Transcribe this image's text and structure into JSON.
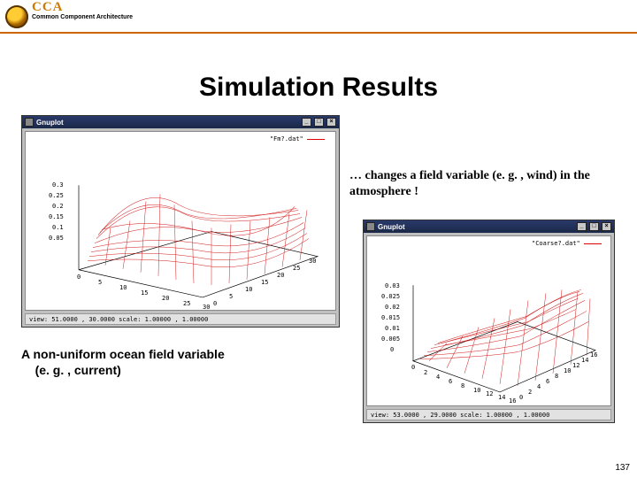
{
  "header": {
    "acronym": "CCA",
    "subtitle": "Common Component Architecture"
  },
  "title": "Simulation Results",
  "caption_right": "… changes a field variable (e. g. , wind) in the atmosphere !",
  "caption_left_l1": "A non-uniform ocean field variable",
  "caption_left_l2": "(e. g. , current)",
  "page_number": "137",
  "plot1": {
    "window_title": "Gnuplot",
    "legend": "\"Fm?.dat\"",
    "status": "view: 51.0000 , 30.0000   scale: 1.00000 , 1.00000",
    "z_ticks": [
      "0.3",
      "0.25",
      "0.2",
      "0.15",
      "0.1",
      "0.05"
    ],
    "x_ticks": [
      "0",
      "5",
      "10",
      "15",
      "20",
      "25",
      "30"
    ],
    "y_ticks": [
      "0",
      "5",
      "10",
      "15",
      "20",
      "25",
      "30"
    ]
  },
  "plot2": {
    "window_title": "Gnuplot",
    "legend": "\"Coarse?.dat\"",
    "status": "view: 53.0000 , 29.0000   scale: 1.00000 , 1.00000",
    "z_ticks": [
      "0.03",
      "0.025",
      "0.02",
      "0.015",
      "0.01",
      "0.005",
      "0"
    ],
    "x_ticks": [
      "0",
      "2",
      "4",
      "6",
      "8",
      "10",
      "12",
      "14",
      "16"
    ],
    "y_ticks": [
      "0",
      "2",
      "4",
      "6",
      "8",
      "10",
      "12",
      "14",
      "16"
    ]
  },
  "chart_data": [
    {
      "type": "surface",
      "title": "",
      "legend": [
        "Fm?.dat"
      ],
      "xlabel": "",
      "ylabel": "",
      "zlabel": "",
      "xlim": [
        0,
        30
      ],
      "ylim": [
        0,
        30
      ],
      "zlim": [
        0.05,
        0.3
      ],
      "x_ticks": [
        0,
        5,
        10,
        15,
        20,
        25,
        30
      ],
      "y_ticks": [
        0,
        5,
        10,
        15,
        20,
        25,
        30
      ],
      "z_ticks": [
        0.05,
        0.1,
        0.15,
        0.2,
        0.25,
        0.3
      ],
      "description": "3D wireframe surface over a 30×30 grid. The field is smooth, roughly planar near z≈0.1 across most of the domain, with a single positive bump near (x≈10, y≈25) peaking just above z≈0.3.",
      "samples": [
        {
          "x": 0,
          "y": 0,
          "z": 0.1
        },
        {
          "x": 30,
          "y": 0,
          "z": 0.1
        },
        {
          "x": 0,
          "y": 30,
          "z": 0.07
        },
        {
          "x": 30,
          "y": 30,
          "z": 0.07
        },
        {
          "x": 10,
          "y": 25,
          "z": 0.3
        },
        {
          "x": 15,
          "y": 15,
          "z": 0.11
        }
      ]
    },
    {
      "type": "surface",
      "title": "",
      "legend": [
        "Coarse?.dat"
      ],
      "xlabel": "",
      "ylabel": "",
      "zlabel": "",
      "xlim": [
        0,
        16
      ],
      "ylim": [
        0,
        16
      ],
      "zlim": [
        0,
        0.03
      ],
      "x_ticks": [
        0,
        2,
        4,
        6,
        8,
        10,
        12,
        14,
        16
      ],
      "y_ticks": [
        0,
        2,
        4,
        6,
        8,
        10,
        12,
        14,
        16
      ],
      "z_ticks": [
        0,
        0.005,
        0.01,
        0.015,
        0.02,
        0.025,
        0.03
      ],
      "description": "3D wireframe surface over a 16×16 grid. A single broad hump centered near (x≈14, y≈8) rising smoothly from z≈0 at the left/front to a peak just under z≈0.03.",
      "samples": [
        {
          "x": 0,
          "y": 0,
          "z": 0.0
        },
        {
          "x": 16,
          "y": 0,
          "z": 0.01
        },
        {
          "x": 0,
          "y": 16,
          "z": 0.003
        },
        {
          "x": 16,
          "y": 16,
          "z": 0.015
        },
        {
          "x": 14,
          "y": 8,
          "z": 0.028
        },
        {
          "x": 6,
          "y": 6,
          "z": 0.003
        }
      ]
    }
  ]
}
